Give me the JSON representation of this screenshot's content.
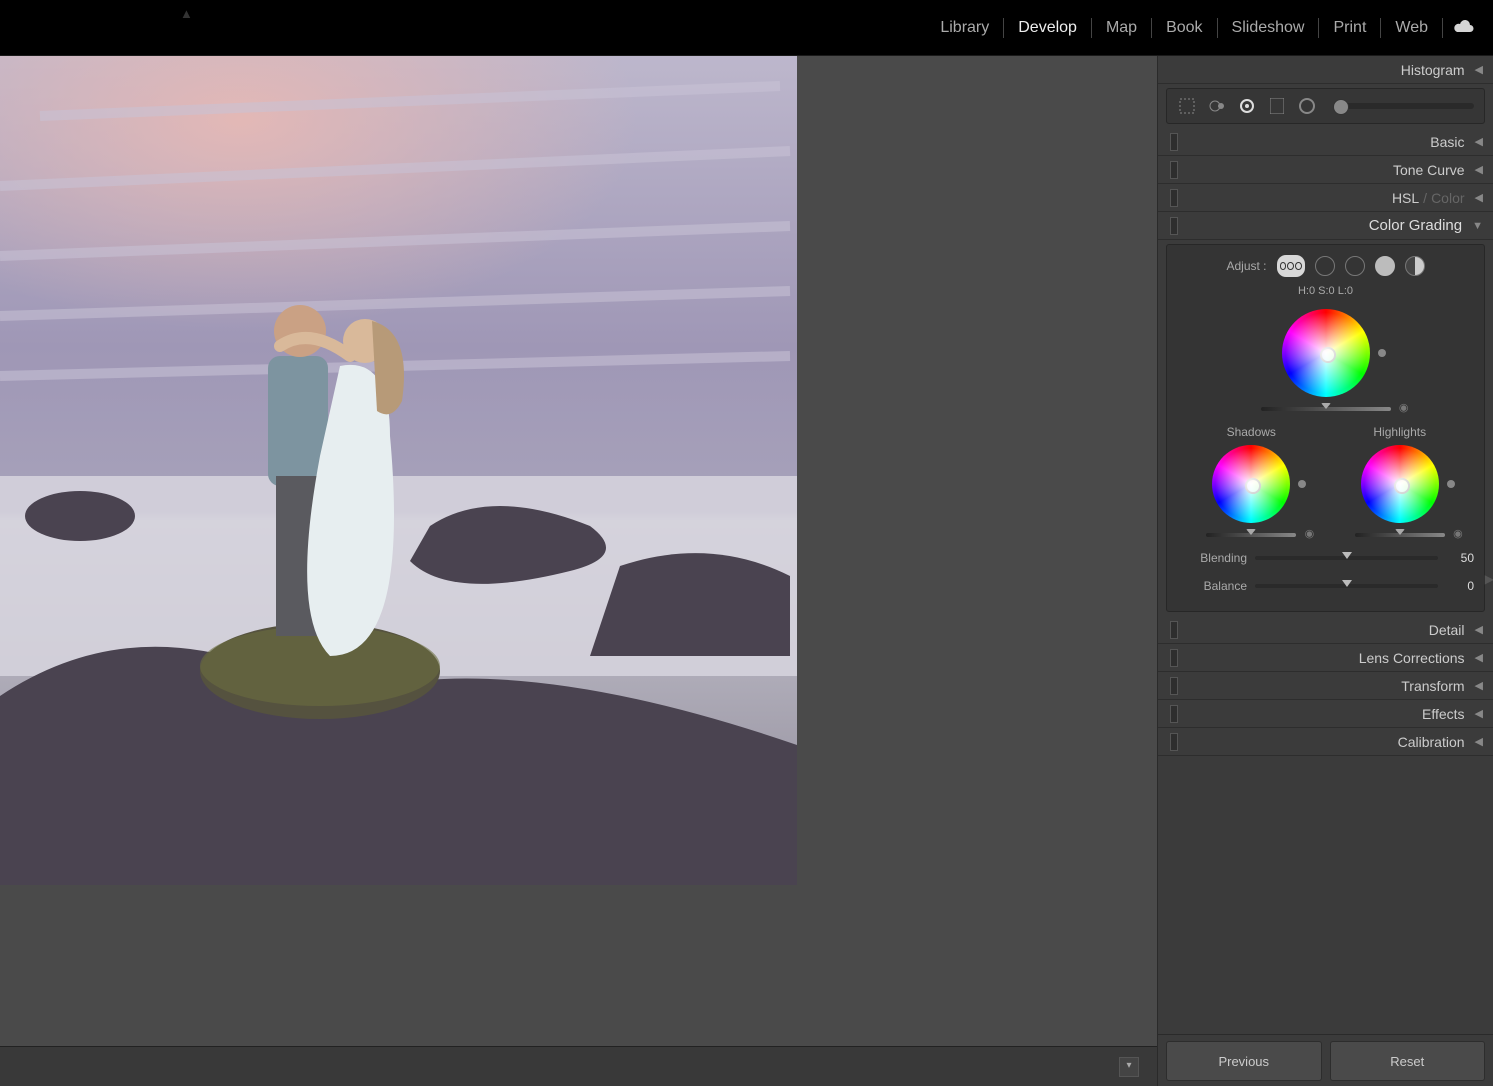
{
  "modules": {
    "items": [
      "Library",
      "Develop",
      "Map",
      "Book",
      "Slideshow",
      "Print",
      "Web"
    ],
    "active": "Develop"
  },
  "rightPanel": {
    "histogram": "Histogram",
    "collapsed": {
      "basic": "Basic",
      "toneCurve": "Tone Curve",
      "hsl": "HSL",
      "hslSep": "/",
      "color": "Color",
      "detail": "Detail",
      "lensCorrections": "Lens Corrections",
      "transform": "Transform",
      "effects": "Effects",
      "calibration": "Calibration"
    },
    "colorGrading": {
      "title": "Color Grading",
      "adjustLabel": "Adjust :",
      "readout": "H:0 S:0 L:0",
      "shadowsLabel": "Shadows",
      "highlightsLabel": "Highlights",
      "blending": {
        "label": "Blending",
        "value": 50
      },
      "balance": {
        "label": "Balance",
        "value": 0
      }
    },
    "buttons": {
      "previous": "Previous",
      "reset": "Reset"
    }
  },
  "colors": {
    "panel": "#3b3b3b",
    "panelDark": "#343434"
  }
}
